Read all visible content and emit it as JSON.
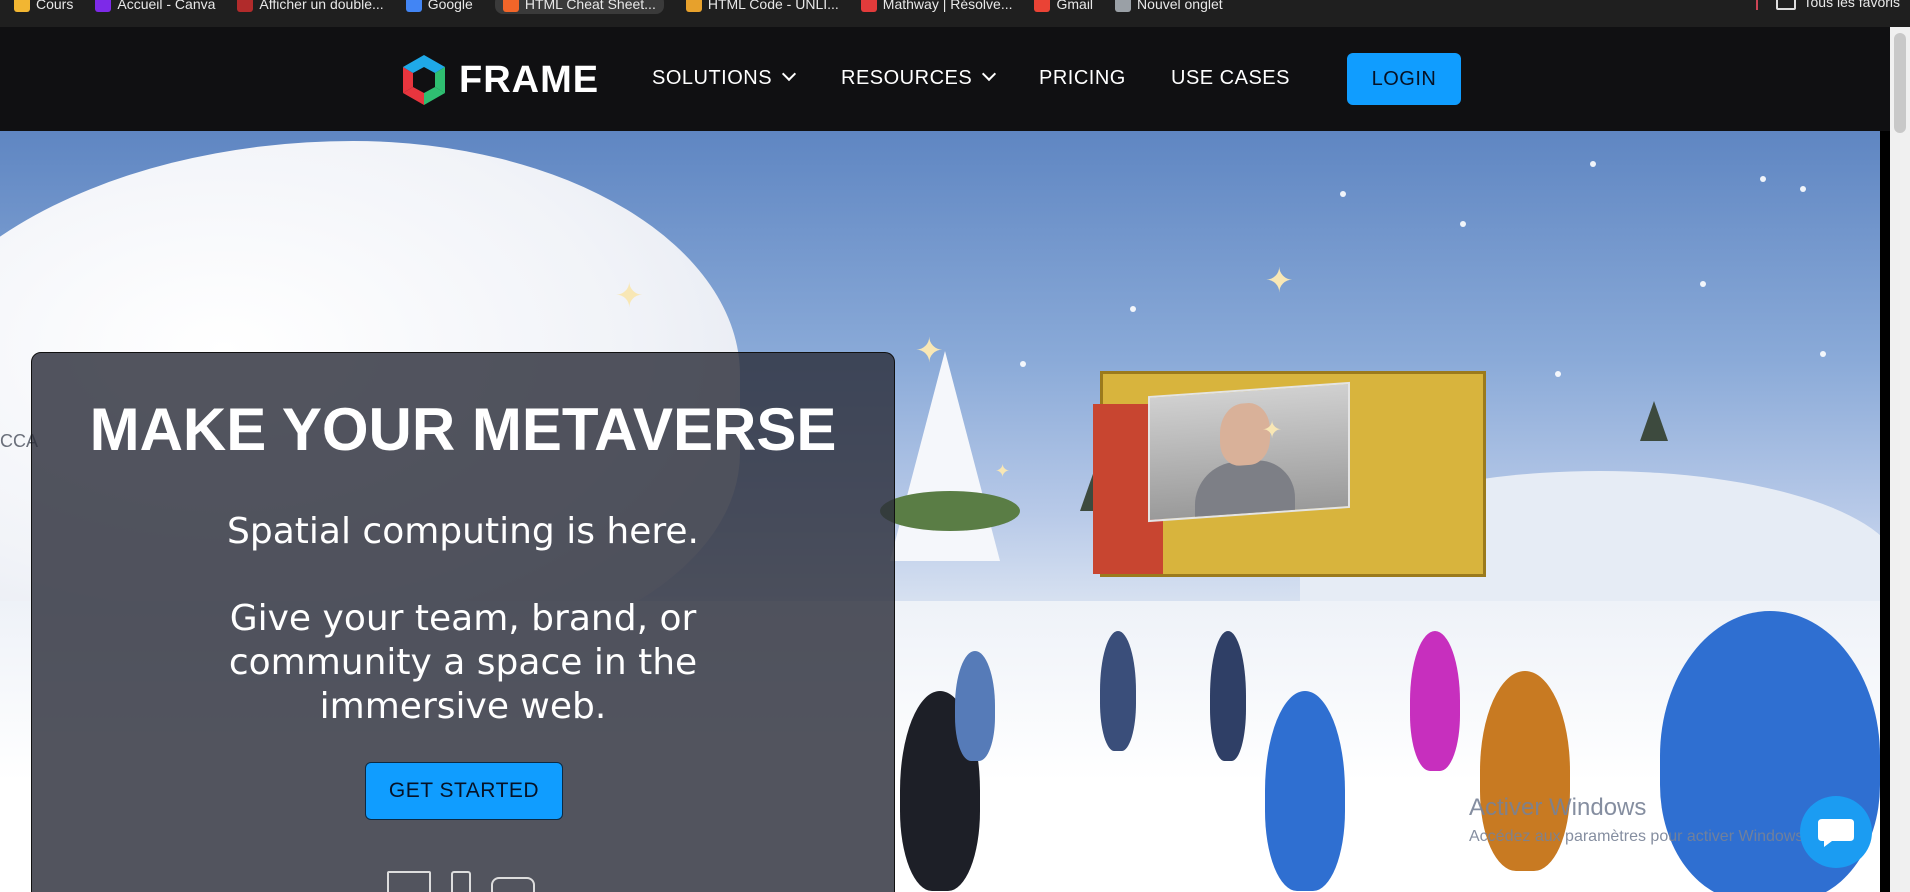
{
  "bookmarks": {
    "items": [
      {
        "label": "Cours",
        "color": "#f2b632"
      },
      {
        "label": "Accueil - Canva",
        "color": "#7d2ae8"
      },
      {
        "label": "Afficher un double...",
        "color": "#b12b2b"
      },
      {
        "label": "Google",
        "color": "#4285f4"
      },
      {
        "label": "HTML Cheat Sheet...",
        "color": "#f16529"
      },
      {
        "label": "HTML Code - UNLI...",
        "color": "#e7a12c"
      },
      {
        "label": "Mathway | Résolve...",
        "color": "#e23b3b"
      },
      {
        "label": "Gmail",
        "color": "#ea4335"
      },
      {
        "label": "Nouvel onglet",
        "color": "#9aa0a6"
      }
    ],
    "all_favorites": "Tous les favoris"
  },
  "nav": {
    "logo_text": "FRAME",
    "solutions": "SOLUTIONS",
    "resources": "RESOURCES",
    "pricing": "PRICING",
    "use_cases": "USE CASES",
    "login": "LOGIN"
  },
  "hero": {
    "headline": "MAKE YOUR METAVERSE",
    "subline": "Spatial computing is here.",
    "description": "Give your team, brand, or community a space in the immersive web.",
    "cta": "GET STARTED",
    "side_text": "CCA"
  },
  "windows_watermark": {
    "title": "Activer Windows",
    "subtitle": "Accédez aux paramètres pour activer Windows."
  },
  "colors": {
    "accent": "#109dff",
    "nav_bg": "#101012"
  }
}
